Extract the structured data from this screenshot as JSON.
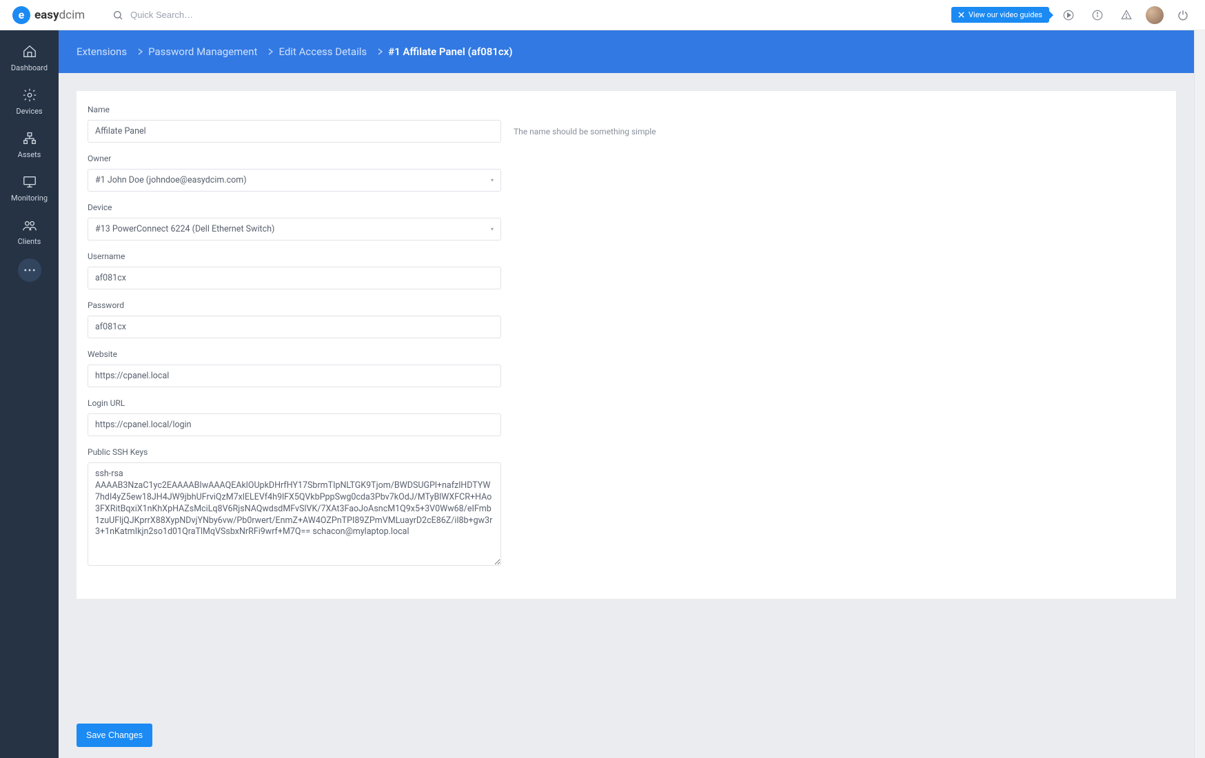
{
  "brand": {
    "name_bold": "easy",
    "name_thin": "dcim"
  },
  "search": {
    "placeholder": "Quick Search…"
  },
  "topbar": {
    "video_guides": "View our video guides"
  },
  "sidebar": {
    "items": [
      {
        "label": "Dashboard"
      },
      {
        "label": "Devices"
      },
      {
        "label": "Assets"
      },
      {
        "label": "Monitoring"
      },
      {
        "label": "Clients"
      }
    ]
  },
  "breadcrumb": {
    "items": [
      "Extensions",
      "Password Management",
      "Edit Access Details",
      "#1 Affilate Panel (af081cx)"
    ]
  },
  "form": {
    "name": {
      "label": "Name",
      "value": "Affilate Panel",
      "hint": "The name should be something simple"
    },
    "owner": {
      "label": "Owner",
      "value": "#1 John Doe (johndoe@easydcim.com)"
    },
    "device": {
      "label": "Device",
      "value": "#13 PowerConnect 6224 (Dell Ethernet Switch)"
    },
    "username": {
      "label": "Username",
      "value": "af081cx"
    },
    "password": {
      "label": "Password",
      "value": "af081cx"
    },
    "website": {
      "label": "Website",
      "value": "https://cpanel.local"
    },
    "login_url": {
      "label": "Login URL",
      "value": "https://cpanel.local/login"
    },
    "ssh": {
      "label": "Public SSH Keys",
      "value": "ssh-rsa AAAAB3NzaC1yc2EAAAABIwAAAQEAklOUpkDHrfHY17SbrmTIpNLTGK9Tjom/BWDSUGPl+nafzlHDTYW7hdI4yZ5ew18JH4JW9jbhUFrviQzM7xlELEVf4h9lFX5QVkbPppSwg0cda3Pbv7kOdJ/MTyBlWXFCR+HAo3FXRitBqxiX1nKhXpHAZsMciLq8V6RjsNAQwdsdMFvSlVK/7XAt3FaoJoAsncM1Q9x5+3V0Ww68/eIFmb1zuUFljQJKprrX88XypNDvjYNby6vw/Pb0rwert/EnmZ+AW4OZPnTPI89ZPmVMLuayrD2cE86Z/il8b+gw3r3+1nKatmIkjn2so1d01QraTlMqVSsbxNrRFi9wrf+M7Q== schacon@mylaptop.local"
    }
  },
  "actions": {
    "save": "Save Changes"
  }
}
